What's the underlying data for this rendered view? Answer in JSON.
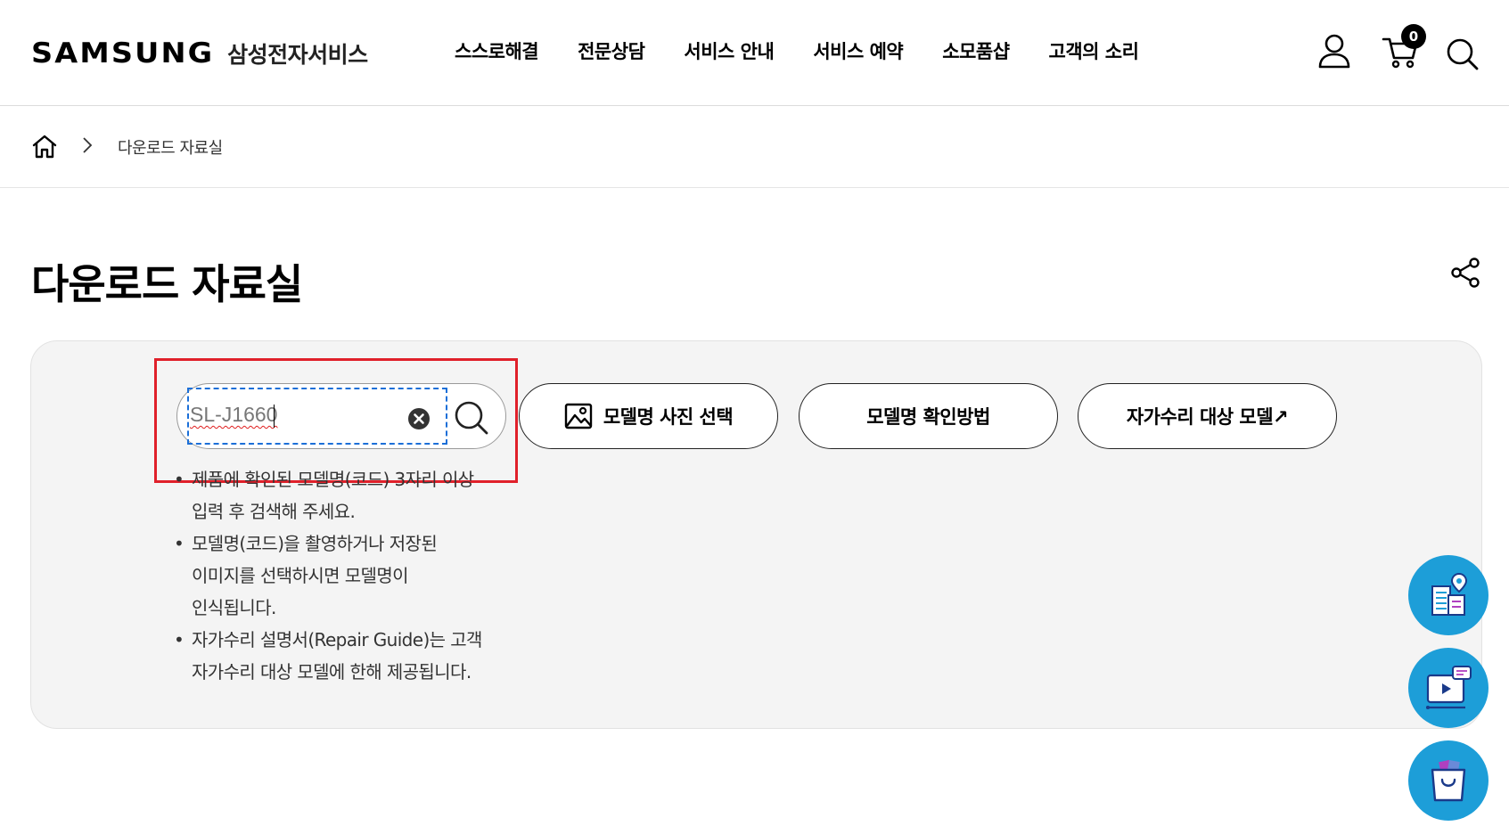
{
  "header": {
    "logo_text": "SAMSUNG",
    "logo_sub": "삼성전자서비스",
    "nav": [
      "스스로해결",
      "전문상담",
      "서비스 안내",
      "서비스 예약",
      "소모품샵",
      "고객의 소리"
    ],
    "cart_count": "0",
    "icons": [
      "user-icon",
      "cart-icon",
      "search-icon"
    ]
  },
  "breadcrumb": {
    "current": "다운로드 자료실"
  },
  "page": {
    "title": "다운로드 자료실"
  },
  "search": {
    "value": "SL-J1660",
    "buttons": {
      "photo": "모델명 사진 선택",
      "howto": "모델명 확인방법",
      "repair": "자가수리 대상 모델↗"
    }
  },
  "notes": [
    [
      "제품에 확인된 모델명(코드) 3자리 이상",
      "입력 후 검색해 주세요."
    ],
    [
      "모델명(코드)을 촬영하거나 저장된",
      "이미지를 선택하시면 모델명이",
      "인식됩니다."
    ],
    [
      "자가수리 설명서(Repair Guide)는 고객",
      "자가수리 대상 모델에 한해 제공됩니다."
    ]
  ],
  "bullet": "•",
  "colors": {
    "accent_blue": "#1d9ed8",
    "highlight_red": "#e0202a",
    "focus_blue": "#1b6fd8"
  },
  "floating_icons": [
    "service-center-icon",
    "video-chat-icon",
    "shopping-bag-icon"
  ]
}
